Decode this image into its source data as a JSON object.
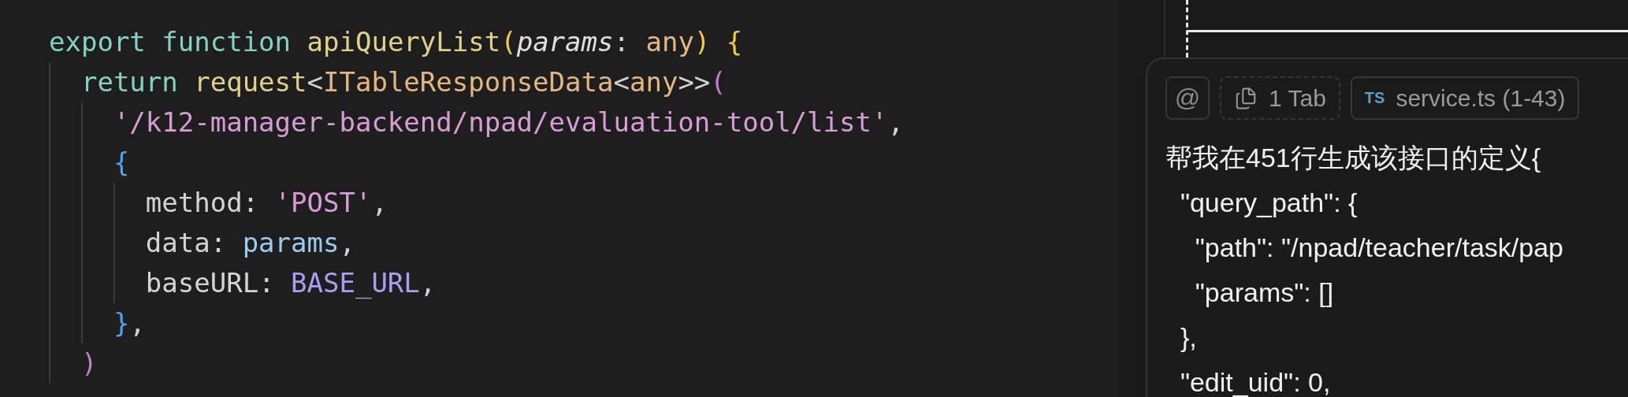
{
  "editor": {
    "lines": [
      {
        "tokens": [
          {
            "text": "export ",
            "kind": "keyword"
          },
          {
            "text": "function ",
            "kind": "keyword"
          },
          {
            "text": "apiQueryList",
            "kind": "function"
          },
          {
            "text": "(",
            "kind": "bracket1"
          },
          {
            "text": "params",
            "kind": "param"
          },
          {
            "text": ": ",
            "kind": "plain"
          },
          {
            "text": "any",
            "kind": "type"
          },
          {
            "text": ") ",
            "kind": "bracket1"
          },
          {
            "text": "{",
            "kind": "bracket1"
          }
        ]
      },
      {
        "tokens": [
          {
            "text": "  return ",
            "kind": "keyword"
          },
          {
            "text": "request",
            "kind": "function"
          },
          {
            "text": "<",
            "kind": "plain"
          },
          {
            "text": "ITableResponseData",
            "kind": "type"
          },
          {
            "text": "<",
            "kind": "plain"
          },
          {
            "text": "any",
            "kind": "type"
          },
          {
            "text": ">>",
            "kind": "plain"
          },
          {
            "text": "(",
            "kind": "bracket2"
          }
        ]
      },
      {
        "tokens": [
          {
            "text": "    '/k12-manager-backend/npad/evaluation-tool/list'",
            "kind": "string"
          },
          {
            "text": ",",
            "kind": "plain"
          }
        ]
      },
      {
        "tokens": [
          {
            "text": "    {",
            "kind": "bracket3"
          }
        ]
      },
      {
        "tokens": [
          {
            "text": "      method: ",
            "kind": "plain"
          },
          {
            "text": "'POST'",
            "kind": "string"
          },
          {
            "text": ",",
            "kind": "plain"
          }
        ]
      },
      {
        "tokens": [
          {
            "text": "      data: ",
            "kind": "plain"
          },
          {
            "text": "params",
            "kind": "variable"
          },
          {
            "text": ",",
            "kind": "plain"
          }
        ]
      },
      {
        "tokens": [
          {
            "text": "      baseURL: ",
            "kind": "plain"
          },
          {
            "text": "BASE_URL",
            "kind": "constant"
          },
          {
            "text": ",",
            "kind": "plain"
          }
        ]
      },
      {
        "tokens": [
          {
            "text": "    }",
            "kind": "bracket3"
          },
          {
            "text": ",",
            "kind": "plain"
          }
        ]
      },
      {
        "tokens": [
          {
            "text": "  )",
            "kind": "bracket2"
          }
        ]
      }
    ]
  },
  "chat": {
    "mention_button": "@",
    "context_chips": [
      {
        "kind": "tabs",
        "label": "1 Tab"
      },
      {
        "kind": "file",
        "badge": "TS",
        "label": "service.ts (1-43)"
      }
    ],
    "prompt_lines": [
      "帮我在451行生成该接口的定义{",
      "  \"query_path\": {",
      "    \"path\": \"/npad/teacher/task/pap",
      "    \"params\": []",
      "  },",
      "  \"edit_uid\": 0,"
    ]
  }
}
